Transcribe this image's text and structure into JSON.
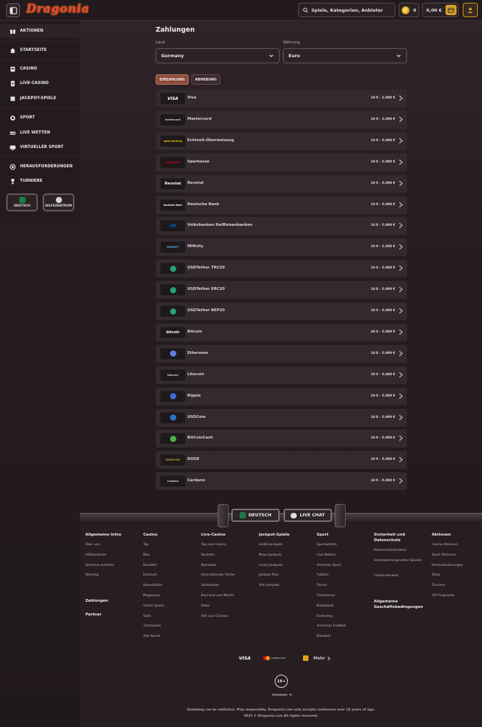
{
  "header": {
    "logo": "Dragonia",
    "search_placeholder": "Spiele, Kategorien, Anbieter",
    "coins": "0",
    "balance": "0,00 €"
  },
  "sidebar": {
    "items": [
      {
        "label": "AKTIONEN",
        "icon": "gift-icon"
      },
      {
        "label": "STARTSEITE",
        "icon": "home-icon"
      },
      {
        "label": "CASINO",
        "icon": "slot-icon"
      },
      {
        "label": "LIVE-CASINO",
        "icon": "card-icon"
      },
      {
        "label": "JACKPOT-SPIELE",
        "icon": "clover-icon"
      },
      {
        "label": "SPORT",
        "icon": "ball-icon"
      },
      {
        "label": "LIVE WETTEN",
        "icon": "live-icon"
      },
      {
        "label": "VIRTUELLER SPORT",
        "icon": "screen-icon"
      },
      {
        "label": "HERAUSFORDERUNGEN",
        "icon": "medal-icon"
      },
      {
        "label": "TURNIERE",
        "icon": "trophy-icon"
      }
    ],
    "language": "DEUTSCH",
    "help": "HILFEZENTRUM"
  },
  "main": {
    "title": "Zahlungen",
    "country_label": "Land",
    "country_value": "Germany",
    "currency_label": "Währung",
    "currency_value": "Euro",
    "tab_deposit": "EINZAHLUNG",
    "tab_withdraw": "ABHEBUNG",
    "methods": [
      {
        "name": "Visa",
        "logo": "VISA",
        "range": "10 € - 2.000 €"
      },
      {
        "name": "Mastercard",
        "logo": "mastercard",
        "range": "10 € - 2.000 €"
      },
      {
        "name": "Echtzeit-Überweisung",
        "logo": "open banking",
        "range": "10 € - 5.000 €"
      },
      {
        "name": "Sparkasse",
        "logo": "Sparkasse",
        "range": "10 € - 5.000 €"
      },
      {
        "name": "Revolut",
        "logo": "Revolut",
        "range": "10 € - 5.000 €"
      },
      {
        "name": "Deutsche Bank",
        "logo": "Deutsche Bank",
        "range": "10 € - 5.000 €"
      },
      {
        "name": "Volksbanken Raiffeisenbanken",
        "logo": "VR",
        "range": "10 € - 5.000 €"
      },
      {
        "name": "Mifinity",
        "logo": "MIFINITY",
        "range": "10 € - 2.500 €"
      },
      {
        "name": "USDTether TRC20",
        "logo": "",
        "range": "10 € - 5.000 €"
      },
      {
        "name": "USDTether ERC20",
        "logo": "",
        "range": "10 € - 5.000 €"
      },
      {
        "name": "USDTether BEP20",
        "logo": "",
        "range": "10 € - 5.000 €"
      },
      {
        "name": "Bitcoin",
        "logo": "bitcoin",
        "range": "30 € - 5.000 €"
      },
      {
        "name": "Ethereum",
        "logo": "",
        "range": "10 € - 5.000 €"
      },
      {
        "name": "Litecoin",
        "logo": "litecoin",
        "range": "10 € - 5.000 €"
      },
      {
        "name": "Ripple",
        "logo": "",
        "range": "10 € - 5.000 €"
      },
      {
        "name": "USDCoin",
        "logo": "",
        "range": "10 € - 5.000 €"
      },
      {
        "name": "BitCoinCash",
        "logo": "",
        "range": "10 € - 5.000 €"
      },
      {
        "name": "DOGE",
        "logo": "DOGECOIN",
        "range": "10 € - 5.000 €"
      },
      {
        "name": "Cardano",
        "logo": "Cardano",
        "range": "10 € - 5.000 €"
      }
    ]
  },
  "footer": {
    "language_button": "DEUTSCH",
    "chat_button": "LIVE CHAT",
    "columns": [
      {
        "title": "Allgemeine Infos",
        "links": [
          "Über uns",
          "Hilfezentrum",
          "Shortcut erstellen",
          "Sitemap"
        ]
      },
      {
        "title": "Casino",
        "links": [
          "Top",
          "Neu",
          "Roulette",
          "Einkäufe",
          "Bonuskäufe",
          "Megaways",
          "Sofort-Spiele",
          "Slots",
          "Tischspiele",
          "Alle Spiele"
        ]
      },
      {
        "title": "Live-Casino",
        "links": [
          "Top Live Casino",
          "Roulette",
          "Blackjack",
          "Internationale Tische",
          "Spielshows",
          "Baccarat und Würfel",
          "Poker",
          "Alle Live Casinos"
        ]
      },
      {
        "title": "Jackpot-Spiele",
        "links": [
          "Heiße Jackpots",
          "Neue Jackpots",
          "Lucky Jackpots",
          "Jackpot Play",
          "Alle Jackpots"
        ]
      },
      {
        "title": "Sport",
        "links": [
          "Sportwetten",
          "Live Wetten",
          "Virtueller Sport",
          "Fußball",
          "Tennis",
          "Tischtennis",
          "Basketball",
          "Eishockey",
          "American Football",
          "Baseball"
        ]
      },
      {
        "title": "Sicherheit und Datenschutz",
        "links": [
          "Datenschutzhinweis",
          "Verantwortungsvolles Spielen",
          "Cookie-Hinweis"
        ]
      },
      {
        "title": "Aktionen",
        "links": [
          "Casino Aktionen",
          "Sport Aktionen",
          "Herausforderungen",
          "Shop",
          "Turniere",
          "VIP Programm"
        ]
      }
    ],
    "zahlungen": "Zahlungen",
    "partner": "Partner",
    "agb": "Allgemeine Geschäftsbedingungen",
    "pay_visa": "VISA",
    "pay_mc": "mastercard",
    "mehr": "Mehr",
    "age": "18+",
    "license": "Lizenzen",
    "disclaimer1": "Gambling can be addictive. Play responsibly. Dragonia.com only accepts customers over 18 years of age.",
    "disclaimer2": "2025 © Dragonia.com All rights reserved."
  },
  "colors": {
    "accent": "#e8413b",
    "gold": "#d4a12a",
    "tab_active": "#8a4d3c"
  }
}
